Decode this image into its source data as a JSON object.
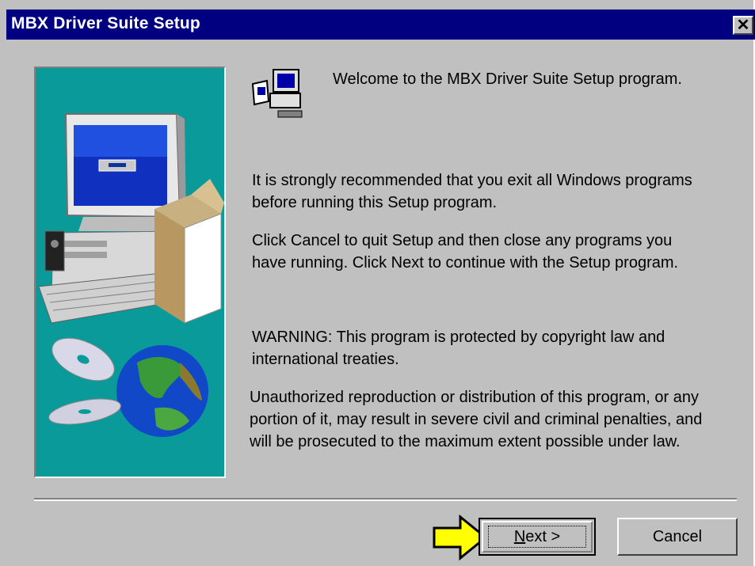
{
  "window": {
    "title": "MBX Driver Suite Setup",
    "close_symbol": "✕",
    "icons": [
      "setup-computer-icon",
      "close-icon"
    ]
  },
  "content": {
    "welcome": "Welcome to the MBX Driver Suite Setup program.",
    "recommend_line1": "It is strongly recommended that you exit all Windows programs",
    "recommend_line2": "before running this Setup program.",
    "cancel_line1": "Click Cancel to quit Setup and then close any programs you",
    "cancel_line2": "have running.  Click Next to continue with the Setup program.",
    "warning_line1": "WARNING: This program is protected by copyright law and",
    "warning_line2": "international treaties.",
    "unauth_line1": "Unauthorized reproduction or distribution of this program, or any",
    "unauth_line2": "portion of it, may result in severe civil and criminal penalties, and",
    "unauth_line3": "will be prosecuted to the maximum extent possible under law."
  },
  "buttons": {
    "next_mnemonic": "N",
    "next_rest": "ext >",
    "cancel": "Cancel"
  },
  "colors": {
    "title_bar": "#000080",
    "panel_bg": "#0a9a9a",
    "dialog_bg": "#c0c0c0",
    "highlight_arrow": "#ffff00"
  }
}
